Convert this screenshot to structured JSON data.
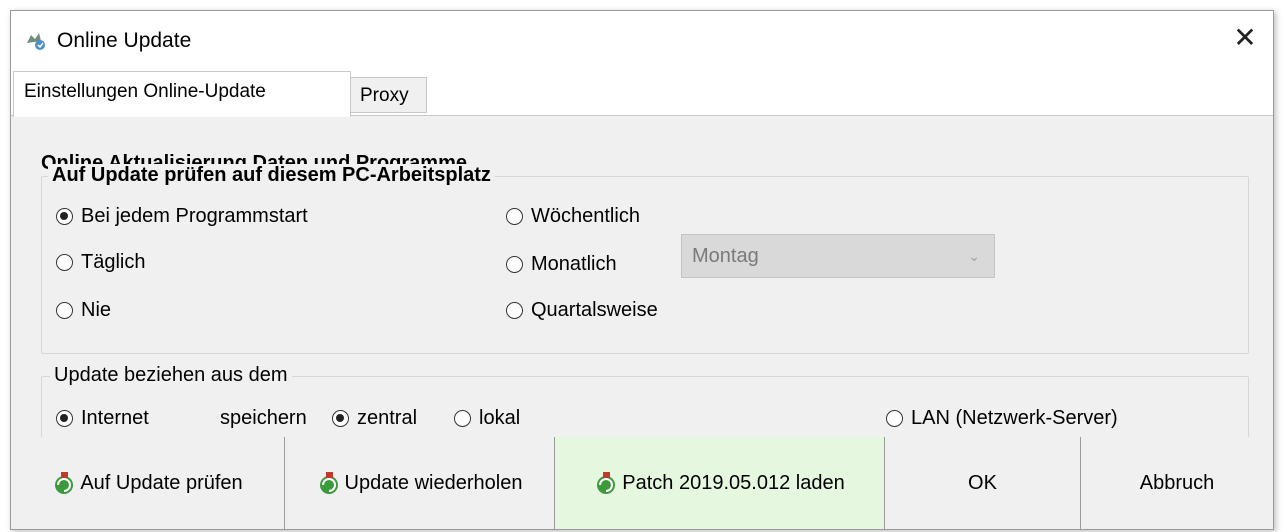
{
  "window": {
    "title": "Online Update",
    "close_glyph": "✕"
  },
  "tabs": [
    {
      "label": "Einstellungen Online-Update"
    },
    {
      "label": "Proxy"
    }
  ],
  "settings": {
    "heading": "Online Aktualisierung Daten und Programme",
    "check_group": {
      "legend": "Auf Update prüfen auf diesem PC-Arbeitsplatz",
      "options": {
        "bei_jedem_programmstart": "Bei jedem Programmstart",
        "taeglich": "Täglich",
        "nie": "Nie",
        "woechentlich": "Wöchentlich",
        "monatlich": "Monatlich",
        "quartalsweise": "Quartalsweise"
      },
      "selected": "Bei jedem Programmstart",
      "weekday_select": {
        "value": "Montag",
        "disabled": true
      }
    },
    "source_group": {
      "legend": "Update beziehen aus dem",
      "internet_label": "Internet",
      "save_label": "speichern",
      "zentral_label": "zentral",
      "lokal_label": "lokal",
      "lan_label": "LAN (Netzwerk-Server)",
      "selected_source": "Internet",
      "selected_storage": "zentral"
    }
  },
  "buttons": {
    "check": "Auf Update prüfen",
    "repeat": "Update wiederholen",
    "patch": "Patch 2019.05.012 laden",
    "ok": "OK",
    "cancel": "Abbruch"
  },
  "colors": {
    "highlight_button": "#e6f7e0",
    "panel": "#f0f0f0",
    "disabled_combo": "#d9d9d9"
  }
}
